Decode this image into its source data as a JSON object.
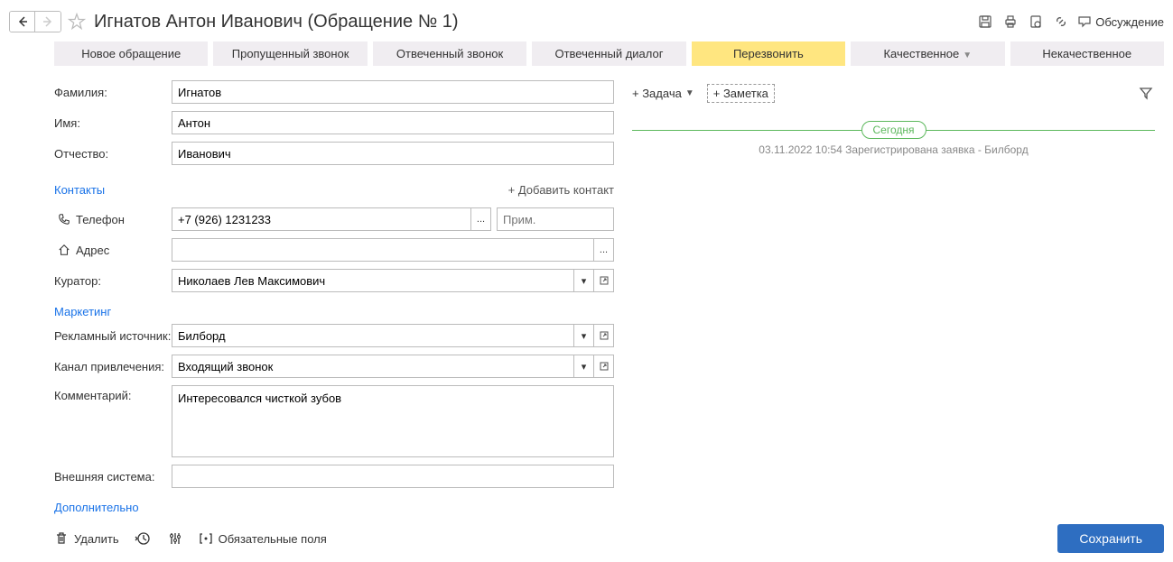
{
  "header": {
    "title": "Игнатов Антон Иванович (Обращение № 1)",
    "discuss": "Обсуждение"
  },
  "tabs": [
    {
      "label": "Новое обращение"
    },
    {
      "label": "Пропущенный звонок"
    },
    {
      "label": "Отвеченный звонок"
    },
    {
      "label": "Отвеченный диалог"
    },
    {
      "label": "Перезвонить"
    },
    {
      "label": "Качественное"
    },
    {
      "label": "Некачественное"
    }
  ],
  "form": {
    "lastname_label": "Фамилия:",
    "lastname": "Игнатов",
    "firstname_label": "Имя:",
    "firstname": "Антон",
    "patronymic_label": "Отчество:",
    "patronymic": "Иванович",
    "contacts_label": "Контакты",
    "add_contact": "+ Добавить контакт",
    "phone_label": "Телефон",
    "phone": "+7 (926) 1231233",
    "phone_note_placeholder": "Прим.",
    "address_label": "Адрес",
    "address": "",
    "curator_label": "Куратор:",
    "curator": "Николаев Лев Максимович",
    "marketing_label": "Маркетинг",
    "ad_source_label": "Рекламный источник:",
    "ad_source": "Билборд",
    "channel_label": "Канал привлечения:",
    "channel": "Входящий звонок",
    "comment_label": "Комментарий:",
    "comment": "Интересовался чисткой зубов",
    "external_label": "Внешняя система:",
    "external": "",
    "additional_label": "Дополнительно"
  },
  "right": {
    "add_task": "+ Задача",
    "add_note": "+ Заметка",
    "today": "Сегодня",
    "entry": "03.11.2022 10:54 Зарегистрирована заявка - Билборд"
  },
  "footer": {
    "delete": "Удалить",
    "required": "Обязательные поля",
    "save": "Сохранить"
  }
}
